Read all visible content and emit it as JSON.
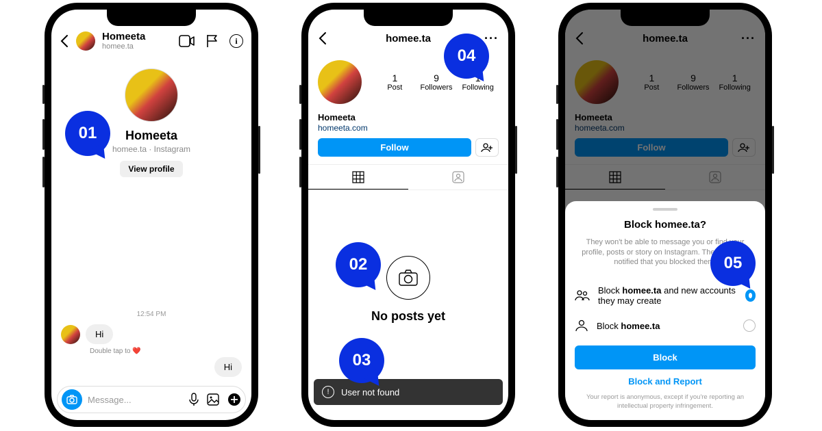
{
  "steps": {
    "s1": "01",
    "s2": "02",
    "s3": "03",
    "s4": "04",
    "s5": "05"
  },
  "phone1": {
    "header": {
      "name": "Homeeta",
      "username": "homee.ta"
    },
    "profile": {
      "name": "Homeeta",
      "sub": "homee.ta · Instagram",
      "view_profile": "View profile"
    },
    "timestamp": "12:54 PM",
    "msg_in": "Hi",
    "double_tap": "Double tap to ❤️",
    "msg_out": "Hi",
    "composer": {
      "placeholder": "Message..."
    }
  },
  "phone2": {
    "username": "homee.ta",
    "stats": {
      "posts_n": "1",
      "posts_l": "Post",
      "followers_n": "9",
      "followers_l": "Followers",
      "following_n": "1",
      "following_l": "Following"
    },
    "display_name": "Homeeta",
    "link": "homeeta.com",
    "follow_label": "Follow",
    "no_posts": "No posts yet",
    "toast": "User not found"
  },
  "phone3": {
    "username": "homee.ta",
    "stats": {
      "posts_n": "1",
      "posts_l": "Post",
      "followers_n": "9",
      "followers_l": "Followers",
      "following_n": "1",
      "following_l": "Following"
    },
    "display_name": "Homeeta",
    "link": "homeeta.com",
    "follow_label": "Follow",
    "sheet": {
      "title": "Block homee.ta?",
      "desc": "They won't be able to message you or find your profile, posts or story on Instagram. They won't be notified that you blocked them.",
      "opt1_pre": "Block ",
      "opt1_b": "homee.ta",
      "opt1_post": " and new accounts they may create",
      "opt2_pre": "Block ",
      "opt2_b": "homee.ta",
      "block": "Block",
      "block_report": "Block and Report",
      "disclaimer": "Your report is anonymous, except if you're reporting an intellectual property infringement."
    }
  }
}
